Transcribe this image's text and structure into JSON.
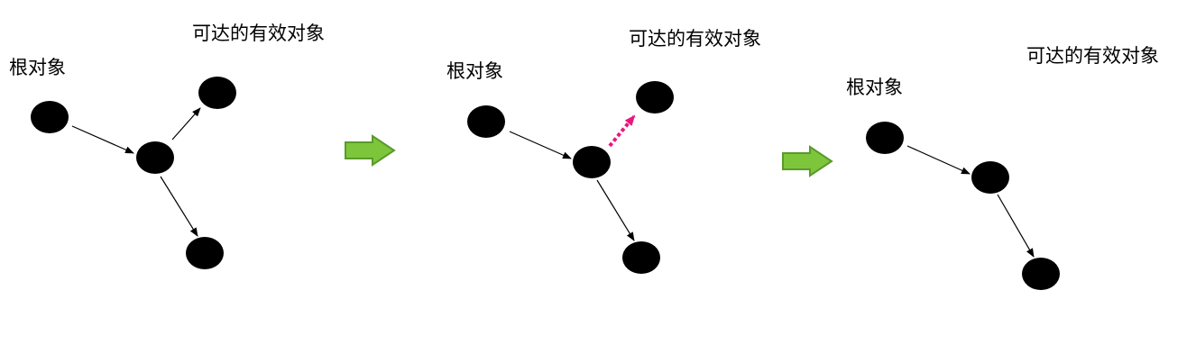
{
  "labels": {
    "root_object": "根对象",
    "reachable_valid_object": "可达的有效对象"
  },
  "colors": {
    "node": "#000000",
    "edge": "#000000",
    "dashed_edge": "#e8177f",
    "transition_arrow_fill": "#7dc63b",
    "transition_arrow_stroke": "#5a9a2a"
  },
  "icons": {
    "transition_arrow": "right-arrow-icon"
  }
}
